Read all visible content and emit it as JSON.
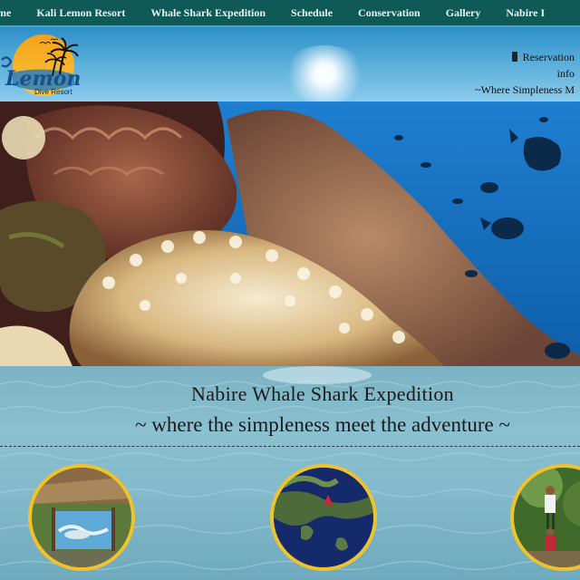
{
  "nav": {
    "items": [
      "me",
      "Kali Lemon Resort",
      "Whale Shark Expedition",
      "Schedule",
      "Conservation",
      "Gallery",
      "Nabire I"
    ]
  },
  "logo": {
    "name": "Lemon",
    "subtitle": "Dive Resort"
  },
  "header": {
    "reservation": "Reservation",
    "info": "info",
    "motto": "~Where Simpleness M"
  },
  "main": {
    "title": "Nabire Whale Shark Expedition",
    "tagline": "~ where the simpleness meet the adventure ~"
  },
  "colors": {
    "nav_bg": "#0f5a56",
    "accent_ring": "#f0c22c",
    "water": "#82bacb"
  }
}
